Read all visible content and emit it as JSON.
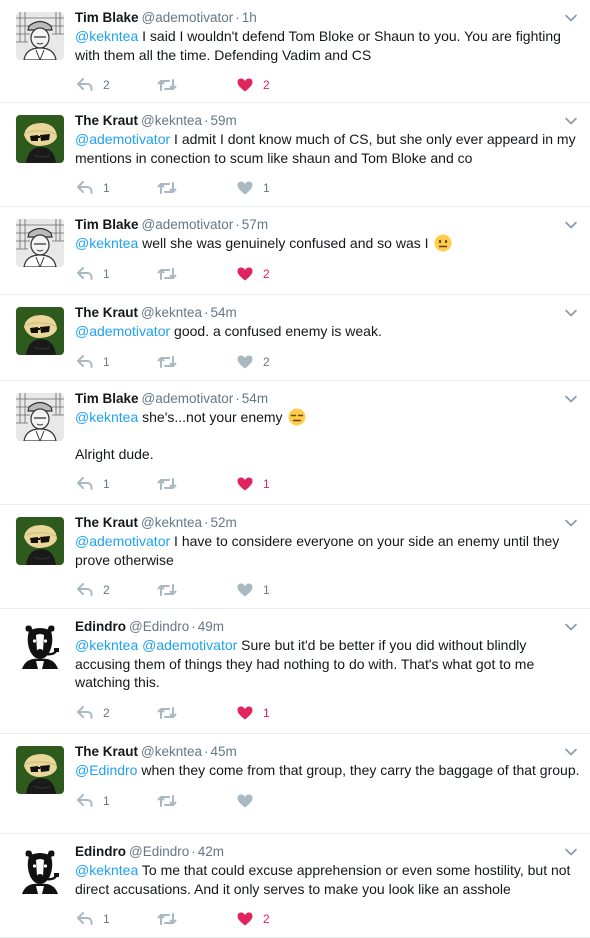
{
  "colors": {
    "link": "#1da1f2",
    "like_active": "#e0245e",
    "muted": "#657786",
    "avatar_kraut_bg": "#2f5a1e"
  },
  "tweets": [
    {
      "name": "Tim Blake",
      "handle": "@ademotivator",
      "sep": "·",
      "time": "1h",
      "lines": [
        {
          "mentions": [
            "@kekntea"
          ],
          "text": " I said I wouldn't defend Tom Bloke or Shaun to you.  You are fighting with them all the time.  Defending Vadim and CS"
        }
      ],
      "reply_count": "2",
      "retweet_count": "",
      "like_count": "2",
      "liked": true,
      "avatar": "tim-blake-avatar"
    },
    {
      "name": "The Kraut",
      "handle": "@kekntea",
      "sep": "·",
      "time": "59m",
      "lines": [
        {
          "mentions": [
            "@ademotivator"
          ],
          "text": " I admit I dont know much of CS, but she only ever appeard in my mentions in conection to scum like shaun and Tom Bloke and co"
        }
      ],
      "reply_count": "1",
      "retweet_count": "",
      "like_count": "1",
      "liked": false,
      "avatar": "kraut-avatar"
    },
    {
      "name": "Tim Blake",
      "handle": "@ademotivator",
      "sep": "·",
      "time": "57m",
      "lines": [
        {
          "mentions": [
            "@kekntea"
          ],
          "text": " well she was genuinely confused and so was I",
          "emoji": "neutral-face-emoji"
        }
      ],
      "reply_count": "1",
      "retweet_count": "",
      "like_count": "2",
      "liked": true,
      "avatar": "tim-blake-avatar"
    },
    {
      "name": "The Kraut",
      "handle": "@kekntea",
      "sep": "·",
      "time": "54m",
      "lines": [
        {
          "mentions": [
            "@ademotivator"
          ],
          "text": " good. a confused enemy is weak."
        }
      ],
      "reply_count": "1",
      "retweet_count": "",
      "like_count": "2",
      "liked": false,
      "avatar": "kraut-avatar"
    },
    {
      "name": "Tim Blake",
      "handle": "@ademotivator",
      "sep": "·",
      "time": "54m",
      "lines": [
        {
          "mentions": [
            "@kekntea"
          ],
          "text": " she's...not your enemy",
          "emoji": "expressionless-face-emoji"
        },
        {
          "mentions": [],
          "text": "Alright dude."
        }
      ],
      "reply_count": "1",
      "retweet_count": "",
      "like_count": "1",
      "liked": true,
      "avatar": "tim-blake-avatar"
    },
    {
      "name": "The Kraut",
      "handle": "@kekntea",
      "sep": "·",
      "time": "52m",
      "lines": [
        {
          "mentions": [
            "@ademotivator"
          ],
          "text": " I have to considere everyone on your side an enemy until they prove otherwise"
        }
      ],
      "reply_count": "2",
      "retweet_count": "",
      "like_count": "1",
      "liked": false,
      "avatar": "kraut-avatar"
    },
    {
      "name": "Edindro",
      "handle": "@Edindro",
      "sep": "·",
      "time": "49m",
      "lines": [
        {
          "mentions": [
            "@kekntea",
            "@ademotivator"
          ],
          "text": " Sure but it'd be better if you did without blindly accusing them of things they had nothing to do with. That's what got to me watching this."
        }
      ],
      "reply_count": "2",
      "retweet_count": "",
      "like_count": "1",
      "liked": true,
      "avatar": "edindro-avatar"
    },
    {
      "name": "The Kraut",
      "handle": "@kekntea",
      "sep": "·",
      "time": "45m",
      "lines": [
        {
          "mentions": [
            "@Edindro"
          ],
          "text": " when they come from that group, they carry the baggage of that group."
        }
      ],
      "reply_count": "1",
      "retweet_count": "",
      "like_count": "",
      "liked": false,
      "avatar": "kraut-avatar"
    },
    {
      "name": "Edindro",
      "handle": "@Edindro",
      "sep": "·",
      "time": "42m",
      "lines": [
        {
          "mentions": [
            "@kekntea"
          ],
          "text": " To me that could excuse apprehension or even some hostility, but not direct accusations. And it only serves to make you look like an asshole"
        }
      ],
      "reply_count": "1",
      "retweet_count": "",
      "like_count": "2",
      "liked": true,
      "avatar": "edindro-avatar"
    }
  ]
}
